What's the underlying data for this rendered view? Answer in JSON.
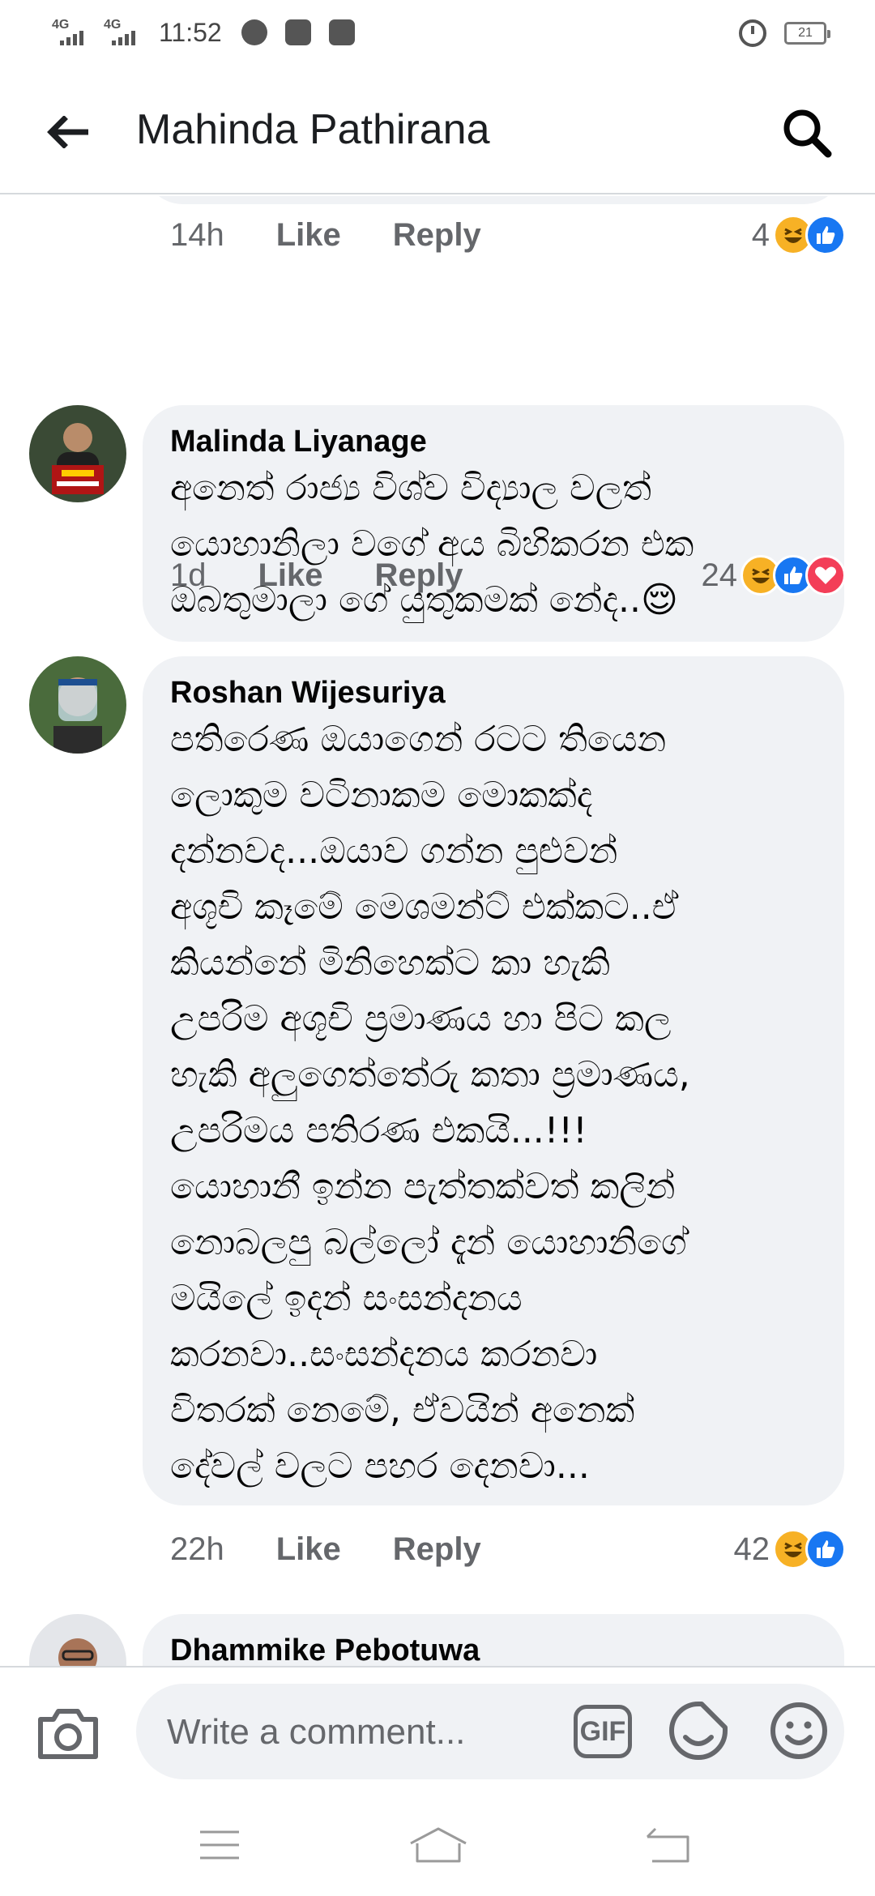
{
  "status_bar": {
    "network_1": "4G",
    "network_2": "4G",
    "time": "11:52",
    "battery": "21"
  },
  "header": {
    "title": "Mahinda Pathirana"
  },
  "previous_comment": {
    "time": "14h",
    "like_label": "Like",
    "reply_label": "Reply",
    "reaction_count": "4",
    "reactions": [
      "laugh",
      "like"
    ]
  },
  "comments": [
    {
      "author": "Malinda Liyanage",
      "text_lines": [
        "අනෙත් රාජ්‍ය විශ්ව විද්‍යාල වලත්",
        "යොහානිලා වගේ අය බිහිකරන එක",
        "ඔබතුමාලා ගේ යුතුකමක් නේද..😌"
      ],
      "time": "1d",
      "like_label": "Like",
      "reply_label": "Reply",
      "reaction_count": "24",
      "reactions": [
        "laugh",
        "like",
        "love"
      ]
    },
    {
      "author": "Roshan Wijesuriya",
      "text_lines": [
        "පතිරෙණ ඔයාගෙන් රටට තියෙන",
        "ලොකුම වටිනාකම මොකක්ද",
        "දන්නවද...ඔයාව ගන්න පුළුවන්",
        "අශූචි කෑමේ මෙශමන්ට් එක්කට..ඒ",
        "කියන්නේ මිනිහෙක්ට කා හැකි",
        "උපරිම අශූචි ප්‍රමාණය හා පිට කල",
        "හැකි අලුගෙත්තේරු කතා ප්‍රමාණය,",
        "උපරිමය පතිරණ එකයි...!!!",
        "යොහානී ඉන්න පැත්තක්වත් කලින්",
        "නොබලපු බල්ලෝ දැන් යොහානිගේ",
        "මයිලේ ඉදන් සංසන්දනය",
        "කරනවා..සංසන්දනය කරනවා",
        "විතරක් නෙමේ, ඒවයින් අනෙක්",
        "දේවල් වලට පහර දෙනවා..."
      ],
      "time": "22h",
      "like_label": "Like",
      "reply_label": "Reply",
      "reaction_count": "42",
      "reactions": [
        "laugh",
        "like"
      ]
    },
    {
      "author": "Dhammike Pebotuwa"
    }
  ],
  "comment_input": {
    "placeholder": "Write a comment...",
    "gif_label": "GIF"
  },
  "colors": {
    "bubble_bg": "#f0f2f5",
    "meta_text": "#65676b",
    "like_blue": "#1877f2",
    "laugh_yellow": "#f7b125",
    "love_red": "#f33e58"
  },
  "icons": [
    "back-arrow-icon",
    "search-icon",
    "camera-icon",
    "sticker-icon",
    "emoji-icon",
    "menu-icon",
    "home-icon",
    "back-icon"
  ]
}
